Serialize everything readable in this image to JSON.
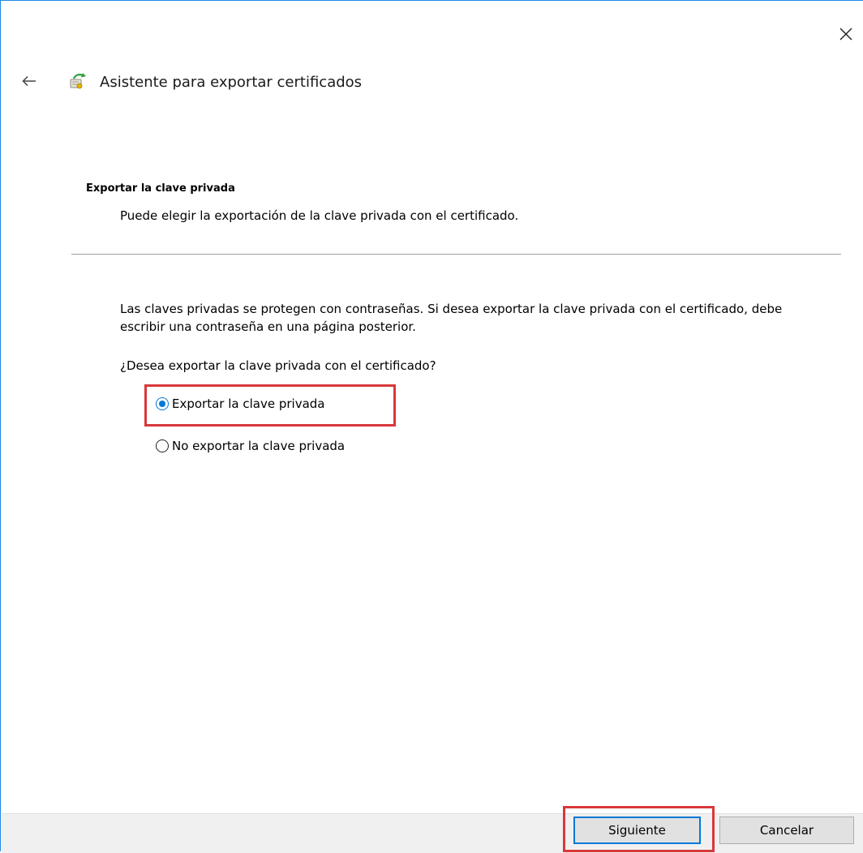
{
  "window": {
    "close_icon": "close-icon"
  },
  "header": {
    "back_icon": "back-arrow-icon",
    "wizard_icon": "certificate-wizard-icon",
    "title": "Asistente para exportar certificados"
  },
  "section": {
    "heading": "Exportar la clave privada",
    "subtitle": "Puede elegir la exportación de la clave privada con el certificado."
  },
  "body": {
    "description": "Las claves privadas se protegen con contraseñas. Si desea exportar la clave privada con el certificado, debe escribir una contraseña en una página posterior.",
    "question": "¿Desea exportar la clave privada con el certificado?",
    "options": [
      {
        "label": "Exportar la clave privada",
        "selected": true
      },
      {
        "label": "No exportar la clave privada",
        "selected": false
      }
    ]
  },
  "footer": {
    "next_label": "Siguiente",
    "cancel_label": "Cancelar"
  },
  "colors": {
    "accent": "#0078d7",
    "highlight": "#d9383a",
    "footer_bg": "#f0f0f0",
    "window_border": "#1e88e5"
  }
}
